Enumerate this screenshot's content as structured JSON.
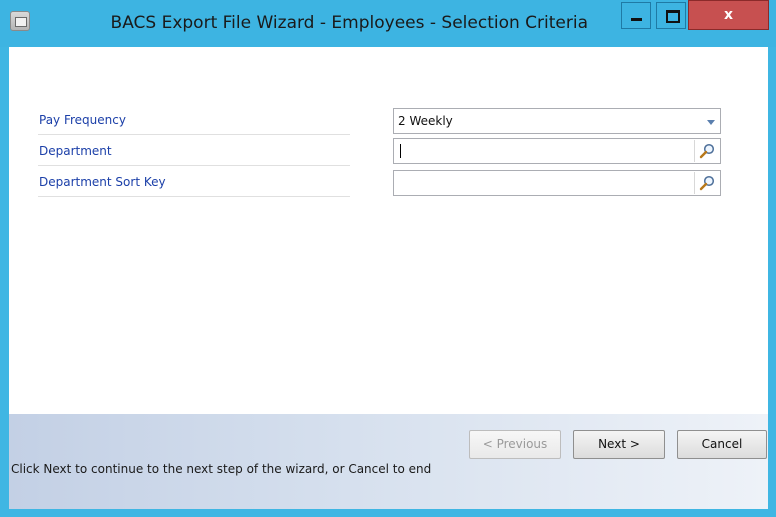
{
  "window": {
    "title": "BACS Export File Wizard - Employees - Selection Criteria",
    "close_label": "x"
  },
  "criteria": [
    {
      "label": "Pay Frequency",
      "value": "2 Weekly",
      "control": "dropdown"
    },
    {
      "label": "Department",
      "value": "",
      "control": "lookup"
    },
    {
      "label": "Department Sort Key",
      "value": "",
      "control": "lookup"
    }
  ],
  "footer": {
    "message": "Click Next to continue to the next step of the wizard, or Cancel to end",
    "previous_label": "< Previous",
    "next_label": "Next >",
    "cancel_label": "Cancel"
  },
  "icons": {
    "app": "wizard-app-icon",
    "lookup": "magnifier-icon",
    "dropdown": "chevron-down-icon"
  },
  "colors": {
    "title_bar": "#3db4e2",
    "label_text": "#1b3fa8",
    "close_button": "#c75050"
  }
}
